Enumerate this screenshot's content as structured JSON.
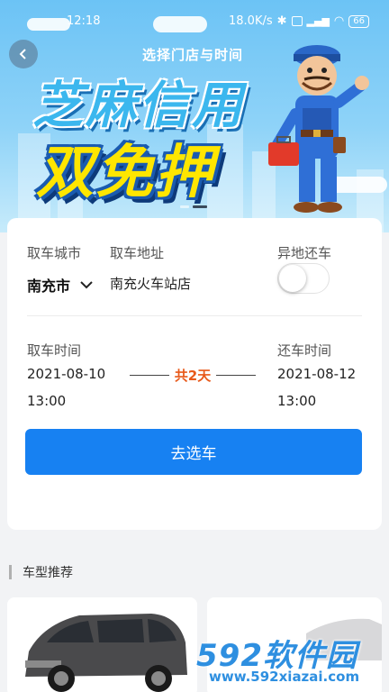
{
  "status_bar": {
    "time": "12:18",
    "network_speed": "18.0K/s",
    "battery": "66",
    "icons": [
      "bluetooth-icon",
      "mute-icon",
      "hd-icon",
      "signal-icon",
      "wifi-icon",
      "battery-icon"
    ]
  },
  "banner": {
    "subtitle": "选择门店与时间",
    "headline_1": "芝麻信用",
    "headline_2": "双免押",
    "carousel_total": 2,
    "carousel_active": 2
  },
  "booking": {
    "pickup_city_label": "取车城市",
    "pickup_city": "南充市",
    "pickup_address_label": "取车地址",
    "pickup_address": "南充火车站店",
    "return_elsewhere_label": "异地还车",
    "return_elsewhere_on": false,
    "pickup_time_label": "取车时间",
    "pickup_date": "2021-08-10",
    "pickup_time": "13:00",
    "duration": "共2天",
    "return_time_label": "还车时间",
    "return_date": "2021-08-12",
    "return_time": "13:00",
    "submit_label": "去选车"
  },
  "recommend": {
    "title": "车型推荐"
  },
  "watermark": {
    "brand": "592软件园",
    "url": "www.592xiazai.com"
  },
  "colors": {
    "accent": "#1781f2",
    "duration": "#e8591a",
    "banner_sky": "#6cc3f5",
    "headline_yellow": "#ffe600"
  }
}
